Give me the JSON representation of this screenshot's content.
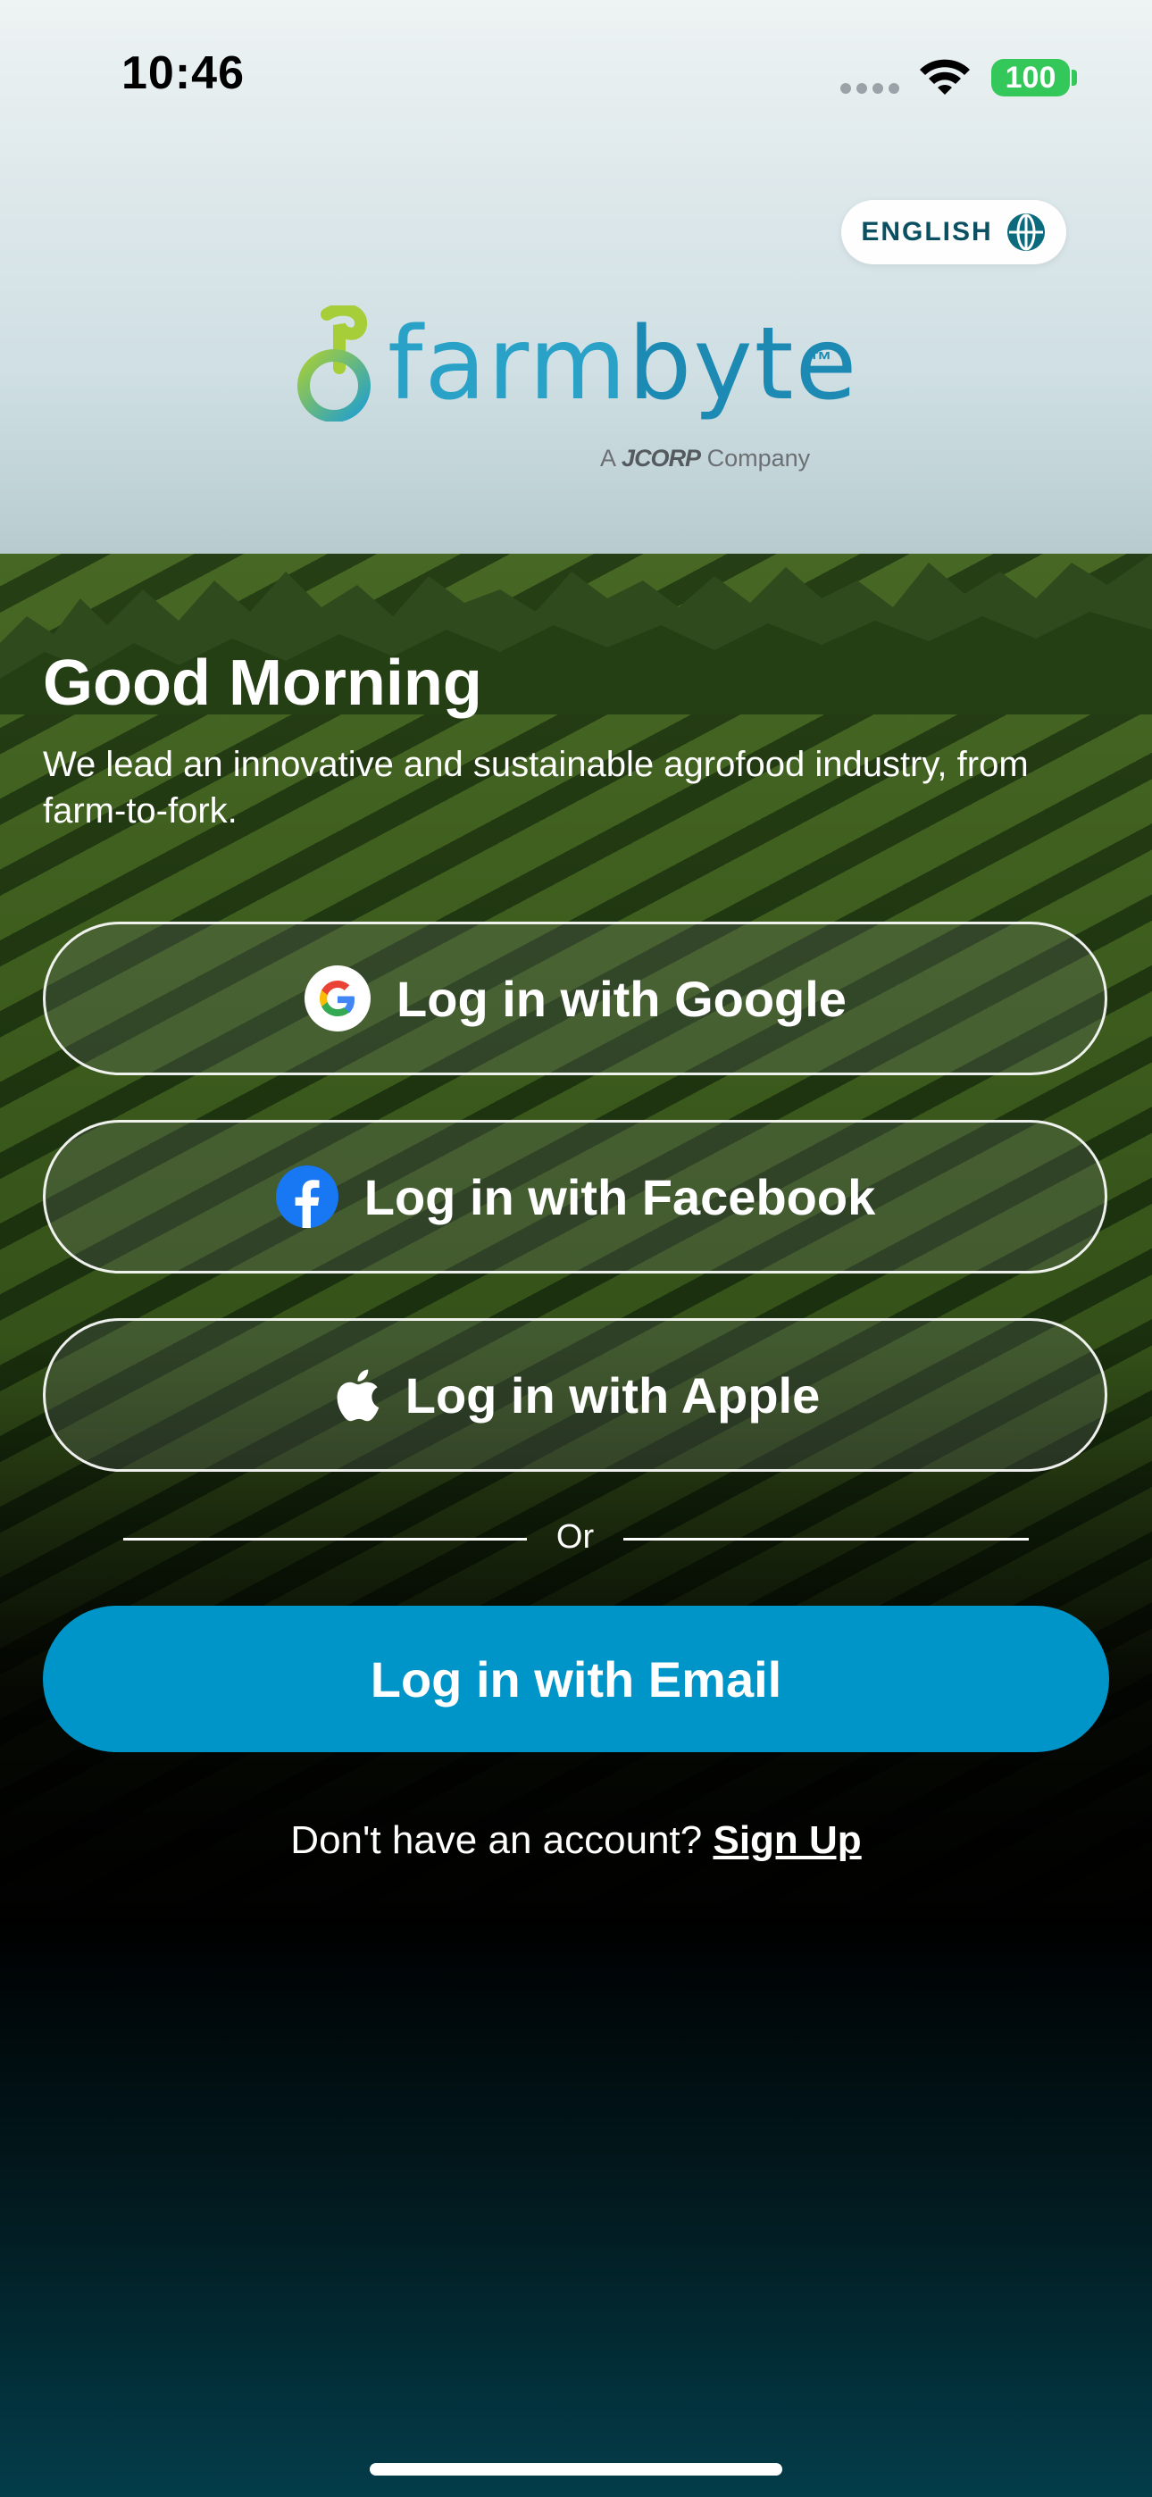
{
  "status_bar": {
    "time": "10:46",
    "battery": "100"
  },
  "language": {
    "label": "ENGLISH",
    "icon": "globe-icon"
  },
  "logo": {
    "word_part1": "farm",
    "word_part2": "byte",
    "trademark": "™",
    "tagline_prefix": "A",
    "tagline_brand": "JCORP",
    "tagline_suffix": "Company"
  },
  "greeting": {
    "title": "Good Morning",
    "subtitle": "We lead an innovative and sustainable agrofood industry, from farm-to-fork."
  },
  "login": {
    "google_label": "Log in with Google",
    "facebook_label": "Log in with Facebook",
    "apple_label": "Log in with Apple",
    "divider_label": "Or",
    "email_label": "Log in with Email"
  },
  "signup": {
    "prompt": "Don't have an account?",
    "link_label": "Sign Up"
  },
  "colors": {
    "primary": "#0095c8",
    "brand_teal": "#0b5061",
    "battery_green": "#34c759"
  }
}
